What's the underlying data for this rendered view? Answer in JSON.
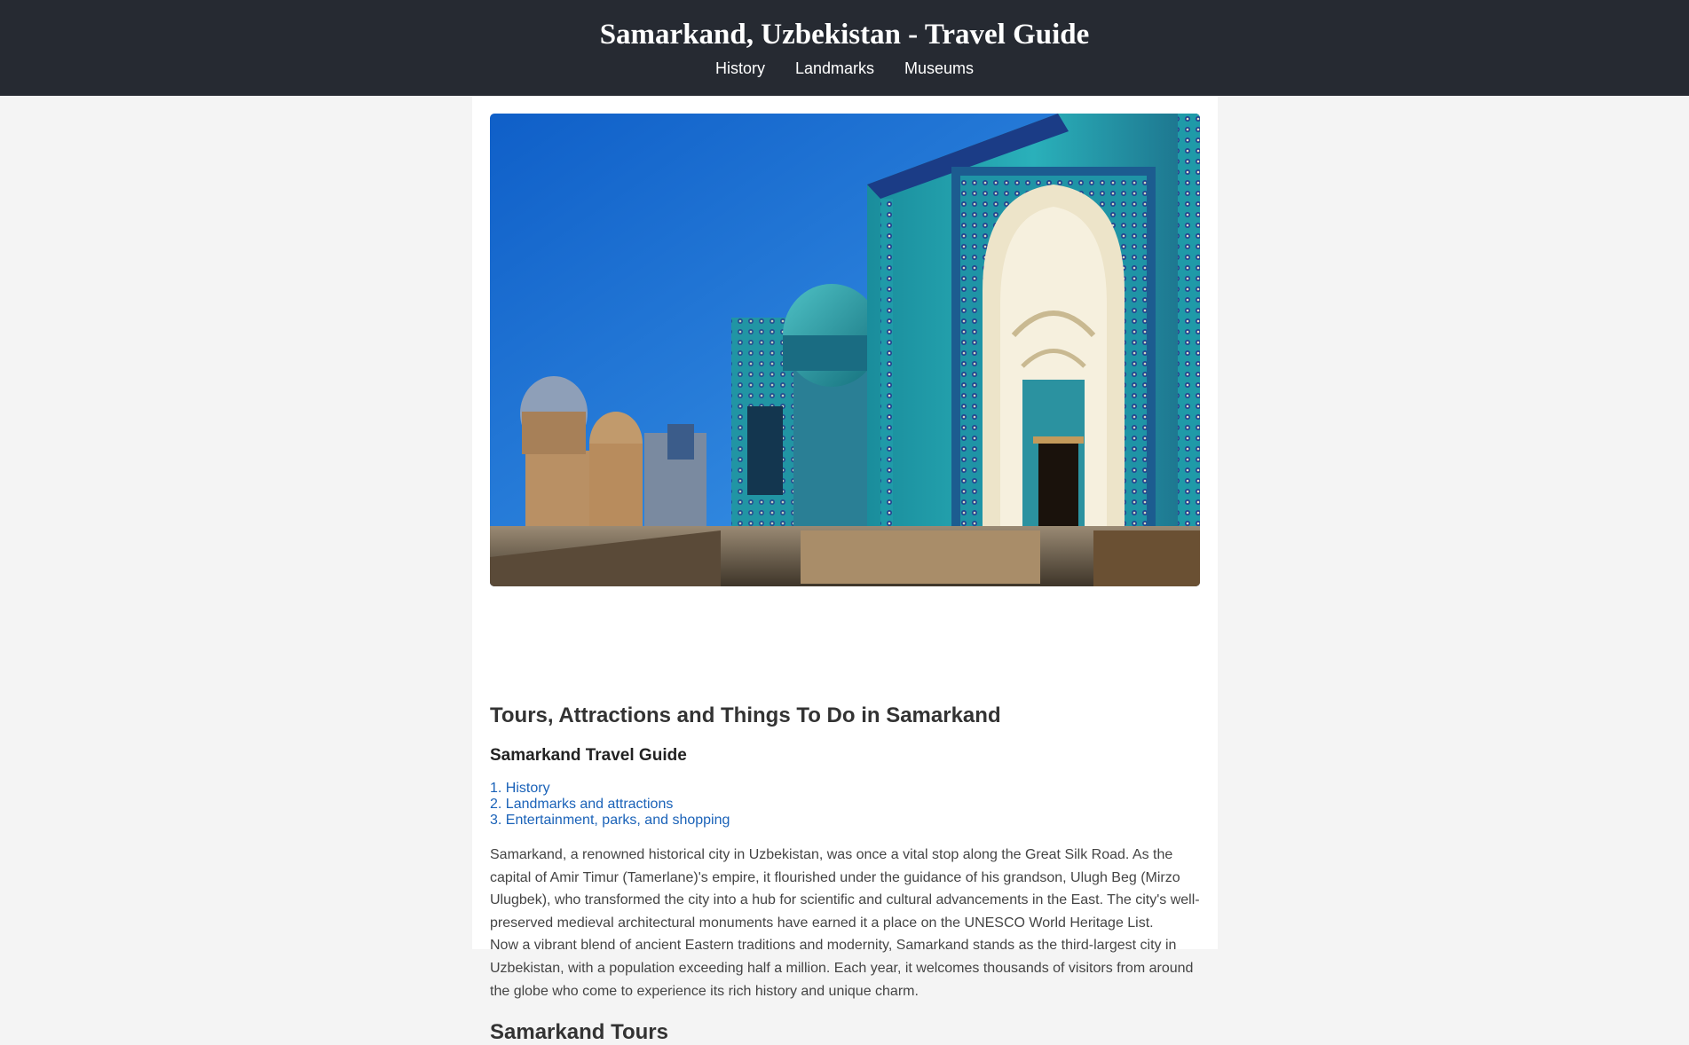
{
  "header": {
    "title": "Samarkand, Uzbekistan - Travel Guide",
    "nav": [
      "History",
      "Landmarks",
      "Museums"
    ]
  },
  "hero": {
    "alt": "Shah-i-Zinda necropolis mausoleums in Samarkand"
  },
  "content": {
    "heading": "Tours, Attractions and Things To Do in Samarkand",
    "guide_heading": "Samarkand Travel Guide",
    "toc": [
      "1. History",
      "2. Landmarks and attractions",
      "3. Entertainment, parks, and shopping"
    ],
    "paragraphs": [
      "Samarkand, a renowned historical city in Uzbekistan, was once a vital stop along the Great Silk Road. As the capital of Amir Timur (Tamerlane)'s empire, it flourished under the guidance of his grandson, Ulugh Beg (Mirzo Ulugbek), who transformed the city into a hub for scientific and cultural advancements in the East. The city's well-preserved medieval architectural monuments have earned it a place on the UNESCO World Heritage List.",
      "Now a vibrant blend of ancient Eastern traditions and modernity, Samarkand stands as the third-largest city in Uzbekistan, with a population exceeding half a million. Each year, it welcomes thousands of visitors from around the globe who come to experience its rich history and unique charm."
    ],
    "tours_heading": "Samarkand Tours"
  },
  "colors": {
    "header_bg": "#262a32",
    "page_bg": "#f4f4f4",
    "link": "#1a62b8",
    "sky": "#1c6fd1",
    "turquoise": "#1c9aa5"
  }
}
